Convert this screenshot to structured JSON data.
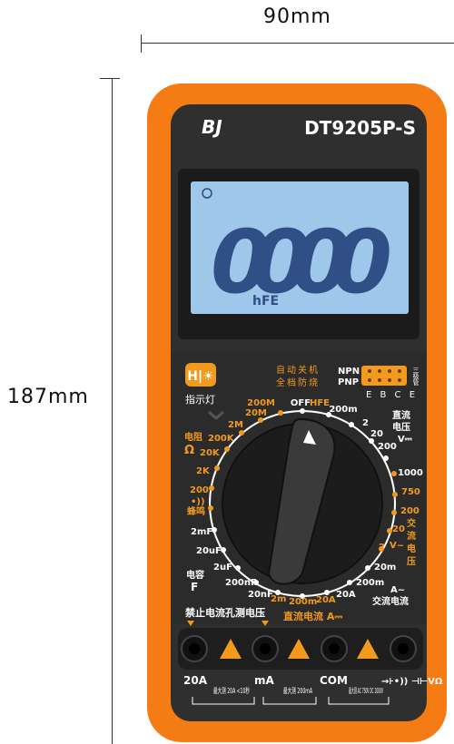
{
  "dimensions": {
    "width_label": "90mm",
    "height_label": "187mm"
  },
  "brand": {
    "logo": "BJ",
    "model": "DT9205P-S"
  },
  "lcd": {
    "reading": "0000",
    "mode_label": "hFE"
  },
  "panel": {
    "hold_button": "H|☀",
    "indicator_light": "指示灯",
    "auto_off_line1": "自动关机",
    "auto_off_line2": "全档防烧",
    "npn": "NPN",
    "pnp": "PNP",
    "socket_pins": "E B C E",
    "socket_side": "三极管",
    "no_live_measure": "禁止电流孔测电压",
    "dc_current": "直流电流 A⎓"
  },
  "dial": {
    "top": [
      "200M",
      "OFF",
      "HFE",
      "200m"
    ],
    "right_dcv": [
      "2",
      "20",
      "200",
      "V⎓",
      "1000"
    ],
    "dcv_caption": [
      "直流",
      "电压"
    ],
    "right_acv": [
      "750",
      "200",
      "20",
      "2",
      "V~"
    ],
    "acv_caption": [
      "交",
      "流",
      "电",
      "压"
    ],
    "right_bottom": [
      "20m",
      "200m",
      "A~"
    ],
    "acv_current_caption": "交流电流",
    "bottom": [
      "2m",
      "200m",
      "20A",
      "20A"
    ],
    "left_ohm": [
      "20M",
      "2M",
      "200K",
      "20K",
      "2K",
      "200"
    ],
    "ohm_caption": [
      "电阻",
      "Ω"
    ],
    "buzzer_caption": [
      "•))",
      "蜂鸣"
    ],
    "left_cap": [
      "2mF",
      "20uF",
      "2uF",
      "200nF",
      "20nF"
    ],
    "cap_caption": [
      "电容",
      "F"
    ]
  },
  "jacks": [
    {
      "label": "20A",
      "note": "最大测 20A <10秒"
    },
    {
      "label": "mA",
      "note": "最大测 200mA"
    },
    {
      "label": "COM",
      "note": "最大测 AC 750V DC 1000V"
    },
    {
      "label": "→⊦•)) ⊣⊢VΩ",
      "note": ""
    }
  ],
  "colors": {
    "body": "#f57c14",
    "panel": "#2b2b2b",
    "lcd": "#9fc7ea",
    "accent": "#f29a1d",
    "knob": "#1c1c1c"
  }
}
